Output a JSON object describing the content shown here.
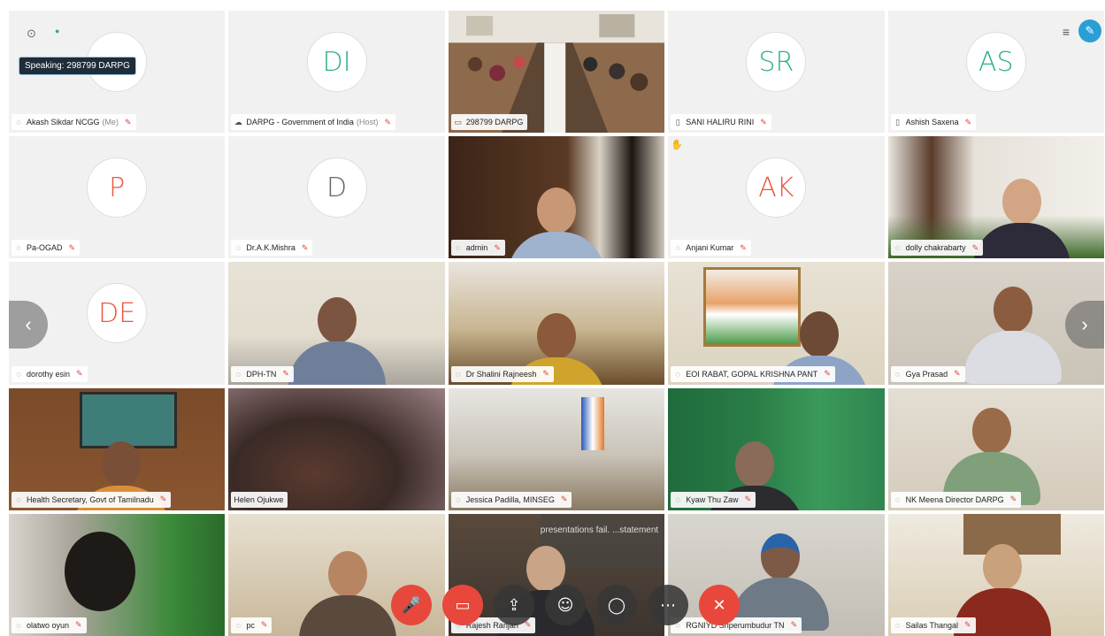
{
  "speaking_banner": "Speaking: 298799 DARPG",
  "tiles": [
    {
      "name": "Akash Sikdar NCGG",
      "suffix": "(Me)"
    },
    {
      "initials": "DI",
      "name": "DARPG - Government of India",
      "suffix": "(Host)"
    },
    {
      "name": "298799 DARPG"
    },
    {
      "initials": "SR",
      "name": "SANI HALIRU RINI"
    },
    {
      "initials": "AS",
      "name": "Ashish Saxena"
    },
    {
      "initials": "P",
      "name": "Pa-OGAD"
    },
    {
      "initials": "D",
      "name": "Dr.A.K.Mishra"
    },
    {
      "name": "admin"
    },
    {
      "initials": "AK",
      "name": "Anjani Kumar"
    },
    {
      "name": "dolly chakrabarty"
    },
    {
      "initials": "DE",
      "name": "dorothy esin"
    },
    {
      "name": "DPH-TN"
    },
    {
      "name": "Dr Shalini Rajneesh"
    },
    {
      "name": "EOI RABAT, GOPAL KRISHNA PANT"
    },
    {
      "name": "Gya Prasad"
    },
    {
      "name": "Health Secretary, Govt of Tamilnadu"
    },
    {
      "name": "Helen Ojukwe"
    },
    {
      "name": "Jessica Padilla, MINSEG"
    },
    {
      "name": "Kyaw Thu Zaw"
    },
    {
      "name": "NK Meena Director DARPG"
    },
    {
      "name": "olatwo oyun"
    },
    {
      "name": "pc"
    },
    {
      "name": "Rajesh Ranjan"
    },
    {
      "name": "RGNIYD Sriperumbudur TN"
    },
    {
      "name": "Sailas Thangal"
    }
  ],
  "overlay_text": "presentations fail. ...statement",
  "colors": {
    "initials": "#2bae8e",
    "initials_alt": "#e9573f",
    "accent": "#2a9fd6",
    "end_call": "#e8483b"
  },
  "toolbar": [
    "mic-muted",
    "video-off",
    "share",
    "participants",
    "chat",
    "more",
    "end-call"
  ]
}
